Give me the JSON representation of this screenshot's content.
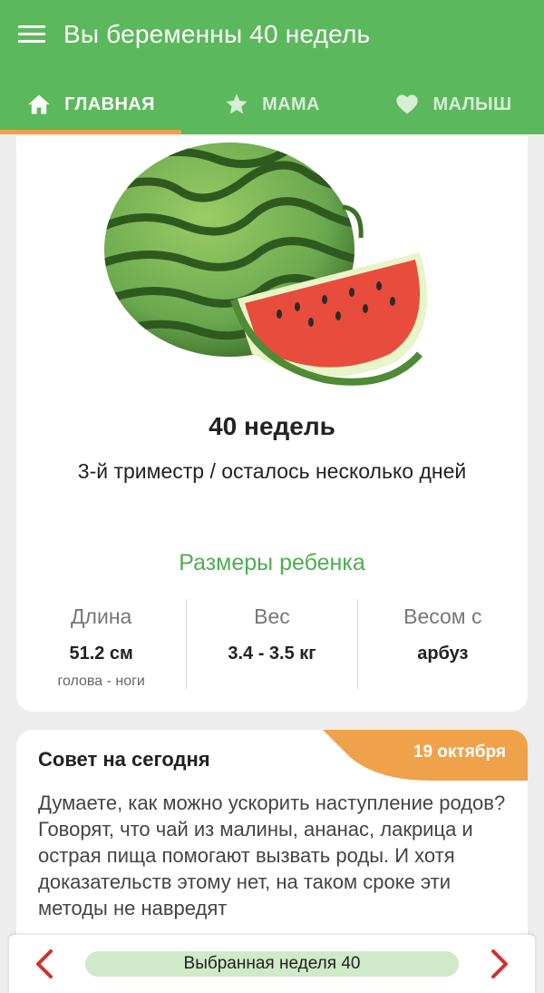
{
  "appbar": {
    "title": "Вы беременны 40 недель",
    "menu_icon": "hamburger-menu-icon"
  },
  "tabs": [
    {
      "label": "ГЛАВНАЯ",
      "icon": "home-icon",
      "active": true
    },
    {
      "label": "МАМА",
      "icon": "star-icon",
      "active": false
    },
    {
      "label": "МАЛЫШ",
      "icon": "heart-icon",
      "active": false
    }
  ],
  "colors": {
    "primary_green": "#5cb85c",
    "accent_orange": "#f0a24a",
    "sizes_title_green": "#4caf50",
    "arrow_red": "#d32f2f",
    "pill_green": "#cfe9c9"
  },
  "main_card": {
    "image": "watermelon-illustration",
    "week_title": "40 недель",
    "week_subtitle": "3-й триместр / осталось несколько дней",
    "sizes_title": "Размеры ребенка",
    "sizes": [
      {
        "label": "Длина",
        "value": "51.2 см",
        "note": "голова - ноги"
      },
      {
        "label": "Вес",
        "value": "3.4 - 3.5 кг",
        "note": ""
      },
      {
        "label": "Весом с",
        "value": "арбуз",
        "note": ""
      }
    ]
  },
  "tip_card": {
    "title": "Совет на сегодня",
    "date": "19 октября",
    "text": "Думаете, как можно ускорить наступление родов? Говорят, что чай из малины, ананас, лакрица и острая пища помогают вызвать роды. И хотя доказательств этому нет, на таком сроке эти методы не навредят"
  },
  "bottom_bar": {
    "selected_week": "Выбранная неделя 40",
    "prev_icon": "chevron-left-icon",
    "next_icon": "chevron-right-icon"
  }
}
